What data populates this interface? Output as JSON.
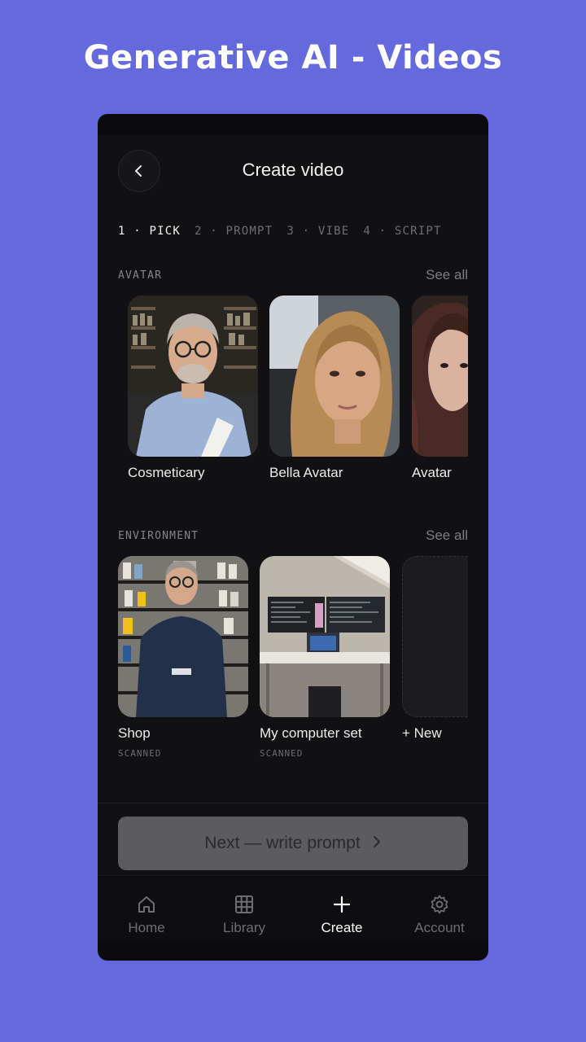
{
  "banner": {
    "title": "Generative AI - Videos"
  },
  "header": {
    "title": "Create video",
    "back_icon": "chevron-left-icon"
  },
  "steps": [
    {
      "label": "1 · PICK",
      "active": true
    },
    {
      "label": "2 · PROMPT",
      "active": false
    },
    {
      "label": "3 · VIBE",
      "active": false
    },
    {
      "label": "4 · SCRIPT",
      "active": false
    }
  ],
  "avatar_section": {
    "label": "AVATAR",
    "see_all": "See all",
    "items": [
      {
        "name": "Cosmeticary"
      },
      {
        "name": "Bella Avatar"
      },
      {
        "name": "Avatar"
      }
    ]
  },
  "environment_section": {
    "label": "ENVIRONMENT",
    "see_all": "See all",
    "items": [
      {
        "name": "Shop",
        "status": "SCANNED"
      },
      {
        "name": "My computer set",
        "status": "SCANNED"
      },
      {
        "name": "+ New",
        "icon": "plus-icon"
      }
    ]
  },
  "next_button": {
    "label": "Next — write prompt",
    "icon": "chevron-right-icon"
  },
  "tabbar": {
    "items": [
      {
        "label": "Home",
        "icon": "home-icon",
        "active": false
      },
      {
        "label": "Library",
        "icon": "grid-icon",
        "active": false
      },
      {
        "label": "Create",
        "icon": "plus-icon",
        "active": true
      },
      {
        "label": "Account",
        "icon": "gear-icon",
        "active": false
      }
    ]
  },
  "colors": {
    "background": "#6569de",
    "screen": "#111114",
    "button": "#5c5c5f"
  }
}
